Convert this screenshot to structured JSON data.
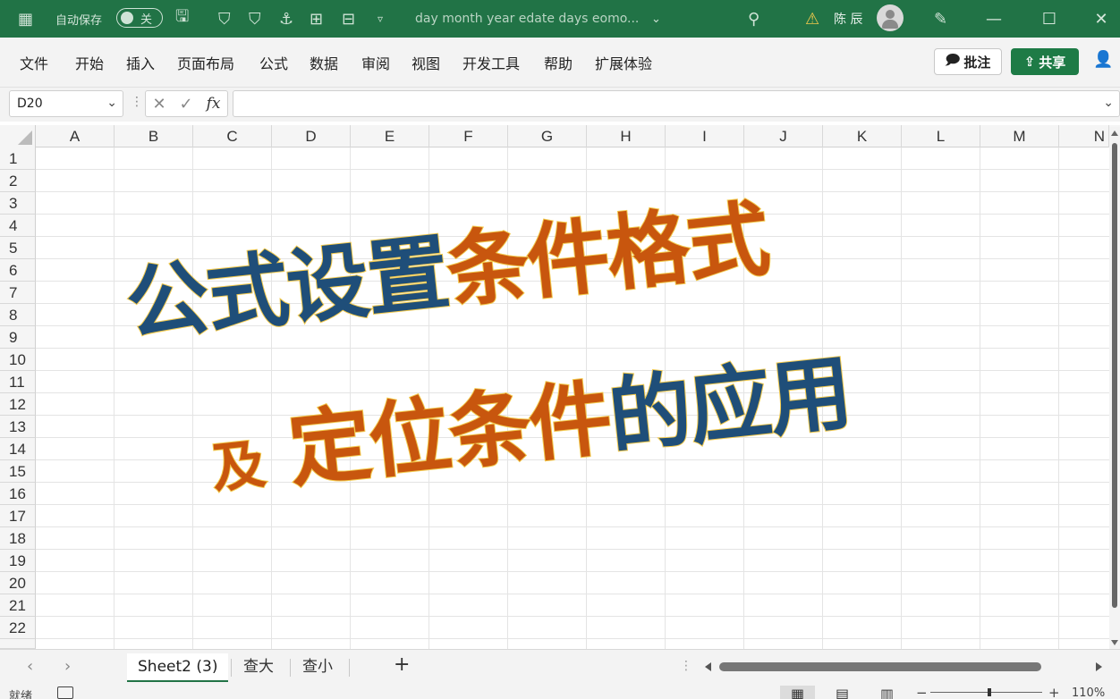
{
  "titlebar": {
    "autosave_label": "自动保存",
    "autosave_state": "关",
    "doc_title": "day month year edate days eomo...",
    "warning_icon": "warning-icon",
    "user_name": "陈 辰",
    "colors": {
      "bar": "#217346",
      "warning": "#f2c94c"
    }
  },
  "menu": {
    "items": [
      "文件",
      "开始",
      "插入",
      "页面布局",
      "公式",
      "数据",
      "审阅",
      "视图",
      "开发工具",
      "帮助",
      "扩展体验"
    ],
    "comment_label": "批注",
    "share_label": "共享"
  },
  "formula_bar": {
    "name_box": "D20",
    "fx_label": "fx",
    "value": ""
  },
  "grid": {
    "columns": [
      "A",
      "B",
      "C",
      "D",
      "E",
      "F",
      "G",
      "H",
      "I",
      "J",
      "K",
      "L",
      "M",
      "N"
    ],
    "rows": [
      "1",
      "2",
      "3",
      "4",
      "5",
      "6",
      "7",
      "8",
      "9",
      "10",
      "11",
      "12",
      "13",
      "14",
      "15",
      "16",
      "17",
      "18",
      "19",
      "20",
      "21",
      "22"
    ]
  },
  "overlay": {
    "line1_blue": "公式设置",
    "line1_orange": "条件格式",
    "line2_small": "及",
    "line2_orange": "定位条件",
    "line2_blue": "的应用",
    "colors": {
      "blue": "#1f4e79",
      "orange": "#c8560e",
      "outline": "#f2c94c"
    }
  },
  "sheets": {
    "tabs": [
      "Sheet2 (3)",
      "查大",
      "查小"
    ],
    "active_index": 0,
    "add_label": "+"
  },
  "status": {
    "ready": "就绪",
    "zoom": "110%"
  }
}
